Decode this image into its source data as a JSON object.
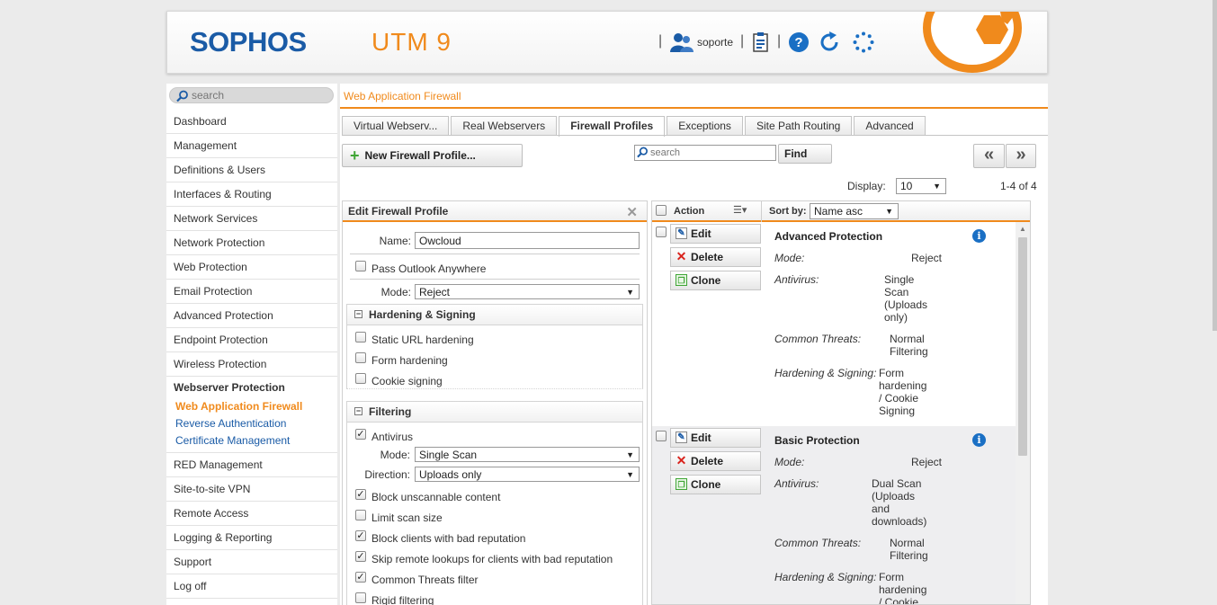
{
  "header": {
    "logo": "SOPHOS",
    "product": "UTM 9",
    "username": "soporte",
    "separator": "|",
    "colors": {
      "brand_blue": "#1a5ba6",
      "brand_orange": "#f08a1c"
    },
    "icons": [
      "user-icon",
      "clipboard-icon",
      "help-icon",
      "refresh-icon",
      "loading-icon"
    ]
  },
  "sidebar": {
    "search_placeholder": "search",
    "items": [
      "Dashboard",
      "Management",
      "Definitions & Users",
      "Interfaces & Routing",
      "Network Services",
      "Network Protection",
      "Web Protection",
      "Email Protection",
      "Advanced Protection",
      "Endpoint Protection",
      "Wireless Protection"
    ],
    "group": {
      "label": "Webserver Protection",
      "subitems": [
        "Web Application Firewall",
        "Reverse Authentication",
        "Certificate Management"
      ],
      "active": "Web Application Firewall"
    },
    "items_after": [
      "RED Management",
      "Site-to-site VPN",
      "Remote Access",
      "Logging & Reporting",
      "Support",
      "Log off"
    ]
  },
  "page": {
    "title": "Web Application Firewall",
    "tabs": [
      "Virtual Webserv...",
      "Real Webservers",
      "Firewall Profiles",
      "Exceptions",
      "Site Path Routing",
      "Advanced"
    ],
    "active_tab": "Firewall Profiles",
    "new_button": "New Firewall Profile...",
    "search_placeholder": "search",
    "find_button": "Find",
    "prev": "«",
    "next": "»",
    "display_label": "Display:",
    "display_value": "10",
    "count": "1-4 of 4"
  },
  "edit": {
    "title": "Edit Firewall Profile",
    "close": "✕",
    "name_label": "Name:",
    "name_value": "Owcloud",
    "pass_outlook": {
      "label": "Pass Outlook Anywhere",
      "checked": false
    },
    "mode_label": "Mode:",
    "mode_value": "Reject",
    "hardening": {
      "title": "Hardening & Signing",
      "items": [
        {
          "label": "Static URL hardening",
          "checked": false
        },
        {
          "label": "Form hardening",
          "checked": false
        },
        {
          "label": "Cookie signing",
          "checked": false
        }
      ]
    },
    "filtering": {
      "title": "Filtering",
      "antivirus": {
        "label": "Antivirus",
        "checked": true
      },
      "mode_label": "Mode:",
      "mode_value": "Single Scan",
      "direction_label": "Direction:",
      "direction_value": "Uploads only",
      "items": [
        {
          "label": "Block unscannable content",
          "checked": true
        },
        {
          "label": "Limit scan size",
          "checked": false
        },
        {
          "label": "Block clients with bad reputation",
          "checked": true
        },
        {
          "label": "Skip remote lookups for clients with bad reputation",
          "checked": true
        },
        {
          "label": "Common Threats filter",
          "checked": true
        },
        {
          "label": "Rigid filtering",
          "checked": false
        }
      ]
    }
  },
  "list": {
    "action_header": "Action",
    "sort_label": "Sort by:",
    "sort_value": "Name asc",
    "buttons": {
      "edit": "Edit",
      "delete": "Delete",
      "clone": "Clone"
    },
    "labels": {
      "mode": "Mode:",
      "antivirus": "Antivirus:",
      "threats": "Common Threats:",
      "hardening": "Hardening & Signing:"
    },
    "profiles": [
      {
        "name": "Advanced Protection",
        "mode": "Reject",
        "antivirus": [
          "Single",
          "Scan",
          "(Uploads",
          "only)"
        ],
        "threats": [
          "Normal",
          "Filtering"
        ],
        "hardening": [
          "Form",
          "hardening",
          "/ Cookie",
          "Signing"
        ]
      },
      {
        "name": "Basic Protection",
        "mode": "Reject",
        "antivirus": [
          "Dual Scan",
          "(Uploads",
          "and",
          "downloads)"
        ],
        "threats": [
          "Normal",
          "Filtering"
        ],
        "hardening": [
          "Form",
          "hardening",
          "/ Cookie"
        ]
      }
    ]
  }
}
